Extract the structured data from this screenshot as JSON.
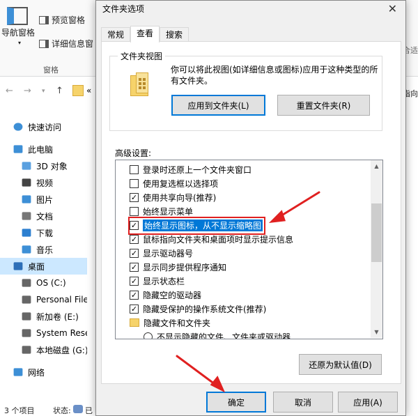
{
  "explorer": {
    "ribbon": {
      "nav_pane": "导航窗格",
      "preview_pane": "预览窗格",
      "details_pane": "详细信息窗",
      "group_label": "窗格",
      "right_cut_1": "合适",
      "right_cut_2": "指向"
    },
    "address_prefix": "«",
    "nav": [
      {
        "label": "快速访问",
        "icon": "star-icon"
      },
      {
        "label": "此电脑",
        "icon": "computer-icon"
      },
      {
        "label": "3D 对象",
        "icon": "cube-icon"
      },
      {
        "label": "视频",
        "icon": "video-icon"
      },
      {
        "label": "图片",
        "icon": "picture-icon"
      },
      {
        "label": "文档",
        "icon": "document-icon"
      },
      {
        "label": "下载",
        "icon": "download-icon"
      },
      {
        "label": "音乐",
        "icon": "music-icon"
      },
      {
        "label": "桌面",
        "icon": "desktop-icon"
      },
      {
        "label": "OS (C:)",
        "icon": "drive-icon"
      },
      {
        "label": "Personal Files",
        "icon": "drive-icon"
      },
      {
        "label": "新加卷 (E:)",
        "icon": "drive-icon"
      },
      {
        "label": "System Reser",
        "icon": "drive-icon"
      },
      {
        "label": "本地磁盘 (G:)",
        "icon": "drive-icon"
      },
      {
        "label": "网络",
        "icon": "network-icon"
      }
    ],
    "status": {
      "count": "3 个项目",
      "state": "状态:",
      "share": "已"
    }
  },
  "dialog": {
    "title": "文件夹选项",
    "close": "✕",
    "tabs": [
      "常规",
      "查看",
      "搜索"
    ],
    "folder_view": {
      "legend": "文件夹视图",
      "description": "你可以将此视图(如详细信息或图标)应用于这种类型的所有文件夹。",
      "apply_button": "应用到文件夹(L)",
      "reset_button": "重置文件夹(R)"
    },
    "advanced_label": "高级设置:",
    "advanced_items": [
      {
        "label": "登录时还原上一个文件夹窗口",
        "checked": false
      },
      {
        "label": "使用复选框以选择项",
        "checked": false
      },
      {
        "label": "使用共享向导(推荐)",
        "checked": true
      },
      {
        "label": "始终显示菜单",
        "checked": false
      },
      {
        "label": "始终显示图标，从不显示缩略图",
        "checked": true
      },
      {
        "label": "鼠标指向文件夹和桌面项时显示提示信息",
        "checked": true
      },
      {
        "label": "显示驱动器号",
        "checked": true
      },
      {
        "label": "显示同步提供程序通知",
        "checked": true
      },
      {
        "label": "显示状态栏",
        "checked": true
      },
      {
        "label": "隐藏空的驱动器",
        "checked": true
      },
      {
        "label": "隐藏受保护的操作系统文件(推荐)",
        "checked": true
      },
      {
        "label": "隐藏文件和文件夹",
        "type": "folder"
      },
      {
        "label": "不显示隐藏的文件、文件夹或驱动器",
        "type": "radio"
      }
    ],
    "restore_defaults": "还原为默认值(D)",
    "ok": "确定",
    "cancel": "取消",
    "apply": "应用(A)"
  },
  "colors": {
    "accent": "#0078d7",
    "annotation": "#e02020",
    "dialog_bg": "#f0f0f0"
  }
}
